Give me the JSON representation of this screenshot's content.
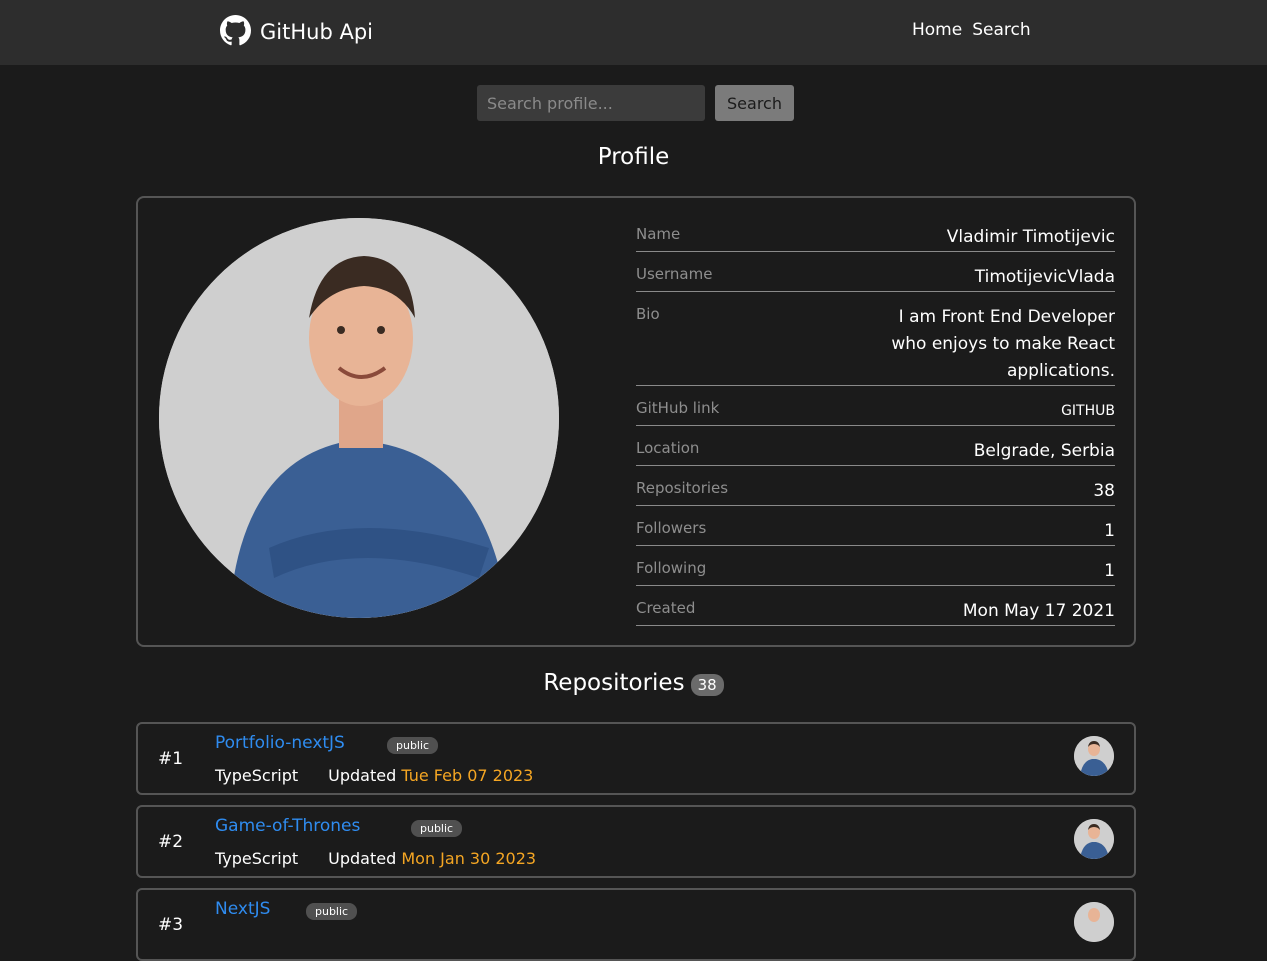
{
  "navbar": {
    "brand": "GitHub Api",
    "links": [
      "Home",
      "Search"
    ]
  },
  "search": {
    "placeholder": "Search profile...",
    "button_label": "Search"
  },
  "profile": {
    "title": "Profile",
    "fields": [
      {
        "label": "Name",
        "value": "Vladimir Timotijevic"
      },
      {
        "label": "Username",
        "value": "TimotijevicVlada"
      },
      {
        "label": "Bio",
        "value": "I am Front End Developer who enjoys to make React applications."
      },
      {
        "label": "GitHub link",
        "value": "GITHUB"
      },
      {
        "label": "Location",
        "value": "Belgrade, Serbia"
      },
      {
        "label": "Repositories",
        "value": "38"
      },
      {
        "label": "Followers",
        "value": "1"
      },
      {
        "label": "Following",
        "value": "1"
      },
      {
        "label": "Created",
        "value": "Mon May 17 2021"
      }
    ]
  },
  "repositories": {
    "title": "Repositories",
    "count": "38",
    "items": [
      {
        "index": "#1",
        "name": "Portfolio-nextJS",
        "visibility": "public",
        "language": "TypeScript",
        "updated_label": "Updated",
        "updated": "Tue Feb 07 2023"
      },
      {
        "index": "#2",
        "name": "Game-of-Thrones",
        "visibility": "public",
        "language": "TypeScript",
        "updated_label": "Updated",
        "updated": "Mon Jan 30 2023"
      },
      {
        "index": "#3",
        "name": "NextJS",
        "visibility": "public",
        "language": "",
        "updated_label": "",
        "updated": ""
      }
    ]
  },
  "colors": {
    "background": "#1b1b1b",
    "navbar": "#2d2d2d",
    "link": "#2f8cf0",
    "date": "#f5a623"
  }
}
